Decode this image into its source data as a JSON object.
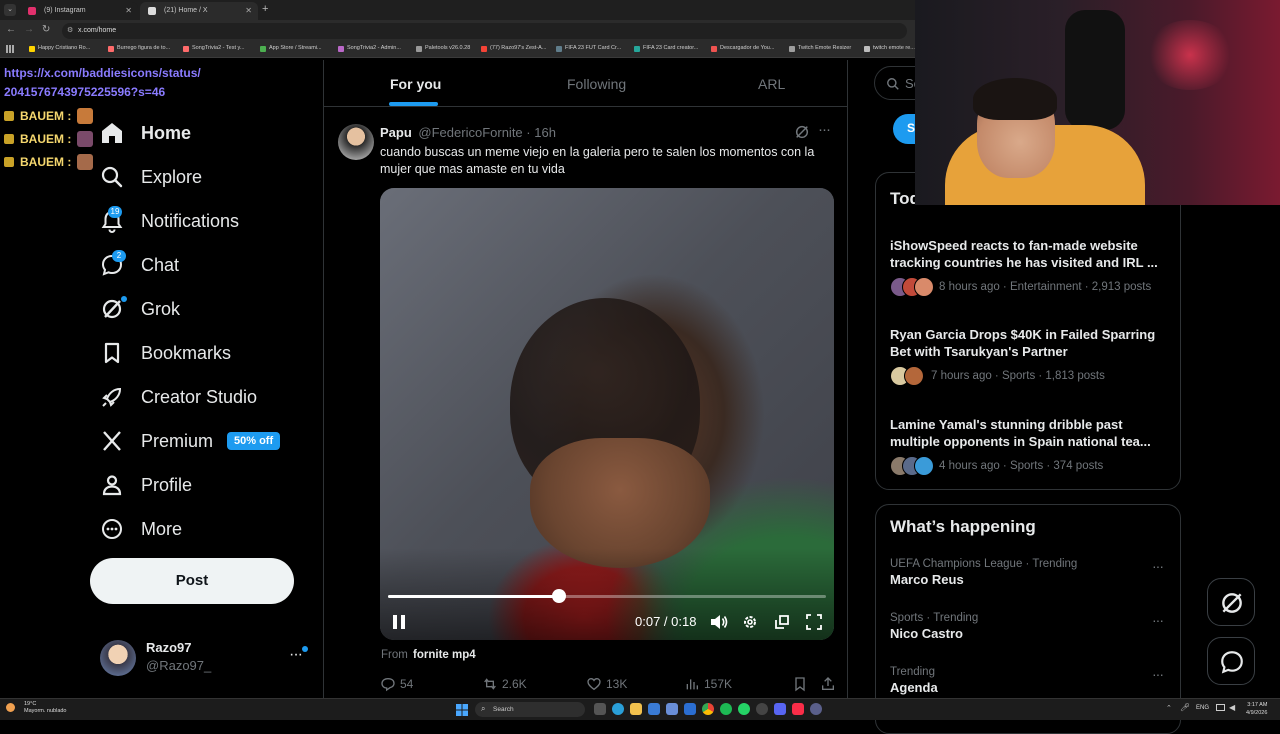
{
  "browser": {
    "tabs": [
      {
        "title": "(9) Instagram",
        "color": "#e1306c",
        "active": false
      },
      {
        "title": "(21) Home / X",
        "color": "#ffffff",
        "active": true
      }
    ],
    "new_tab": "+",
    "address": "x.com/home",
    "bookmarks": [
      {
        "label": "Happy Cristiano Ro...",
        "color": "#ffd400"
      },
      {
        "label": "Burrego figura de to...",
        "color": "#ff6b6b"
      },
      {
        "label": "SongTrivia2 - Test y...",
        "color": "#ff6b6b"
      },
      {
        "label": "App Store / Streami...",
        "color": "#4caf50"
      },
      {
        "label": "SongTrivia2 - Admin...",
        "color": "#ba68c8"
      },
      {
        "label": "Paletools v26.0.28",
        "color": "#999999"
      },
      {
        "label": "(77) Razo97's Zest-A...",
        "color": "#f44336"
      },
      {
        "label": "FIFA 23 FUT Card Cr...",
        "color": "#607d8b"
      },
      {
        "label": "FIFA 23 Card creator...",
        "color": "#26a69a"
      },
      {
        "label": "Descargador de You...",
        "color": "#ef5350"
      },
      {
        "label": "Twitch Emote Resizer",
        "color": "#9e9e9e"
      },
      {
        "label": "twitch emote re...",
        "color": "#bdbdbd"
      }
    ]
  },
  "chat_overlay": {
    "link": "https://x.com/baddiesicons/status/2041576743975225596?s=46",
    "link_line1": "https://x.com/baddiesicons/status/",
    "link_line2": "2041576743975225596?s=46",
    "messages": [
      "BAUEM :",
      "BAUEM :",
      "BAUEM :"
    ]
  },
  "nav": {
    "items": [
      {
        "label": "Home",
        "icon": "home-icon",
        "active": true
      },
      {
        "label": "Explore",
        "icon": "search-icon"
      },
      {
        "label": "Notifications",
        "icon": "bell-icon",
        "badge": "19"
      },
      {
        "label": "Chat",
        "icon": "chat-icon",
        "badge": "2"
      },
      {
        "label": "Grok",
        "icon": "grok-icon",
        "dot": true
      },
      {
        "label": "Bookmarks",
        "icon": "bookmark-icon"
      },
      {
        "label": "Creator Studio",
        "icon": "rocket-icon"
      },
      {
        "label": "Premium",
        "icon": "x-logo-icon",
        "pill": "50% off"
      },
      {
        "label": "Profile",
        "icon": "person-icon"
      },
      {
        "label": "More",
        "icon": "more-circle-icon"
      }
    ],
    "post_button": "Post",
    "account": {
      "name": "Razo97",
      "handle": "@Razo97_"
    }
  },
  "feed": {
    "tabs": [
      "For you",
      "Following",
      "ARL"
    ],
    "post": {
      "author": "Papu",
      "handle": "@FedericoFornite",
      "time": "16h",
      "text": "cuando buscas un meme viejo en la galeria pero te salen los momentos con la mujer que mas amaste en tu vida",
      "video": {
        "current": "0:07",
        "total": "0:18",
        "time_label": "0:07 / 0:18",
        "progress": 0.39
      },
      "from_prefix": "From",
      "from_source": "fornite mp4",
      "stats": {
        "replies": "54",
        "reposts": "2.6K",
        "likes": "13K",
        "views": "157K"
      }
    }
  },
  "right": {
    "search_placeholder": "Se",
    "subscribe_label": "S",
    "trends_title": "Tod",
    "trends": [
      {
        "title": "iShowSpeed reacts to fan-made website tracking countries he has visited and IRL ...",
        "meta": "8 hours ago · Entertainment · 2,913 posts"
      },
      {
        "title": "Ryan Garcia Drops $40K in Failed Sparring Bet with Tsarukyan's Partner",
        "meta": "7 hours ago · Sports · 1,813 posts"
      },
      {
        "title": "Lamine Yamal's stunning dribble past multiple opponents in Spain national tea...",
        "meta": "4 hours ago · Sports · 374 posts"
      }
    ],
    "whats_happening_title": "What’s happening",
    "happening": [
      {
        "category": "UEFA Champions League · Trending",
        "name": "Marco Reus"
      },
      {
        "category": "Sports · Trending",
        "name": "Nico Castro"
      },
      {
        "category": "Trending",
        "name": "Agenda"
      }
    ]
  },
  "taskbar": {
    "weather_temp": "19°C",
    "weather_desc": "Mayorm. nublado",
    "search": "Search",
    "lang": "ENG",
    "time": "3:17 AM",
    "date": "4/9/2026"
  },
  "colors": {
    "accent": "#1d9bf0",
    "bg": "#000000",
    "border": "#2f3336",
    "muted": "#71767b",
    "link": "#8a7bff"
  }
}
